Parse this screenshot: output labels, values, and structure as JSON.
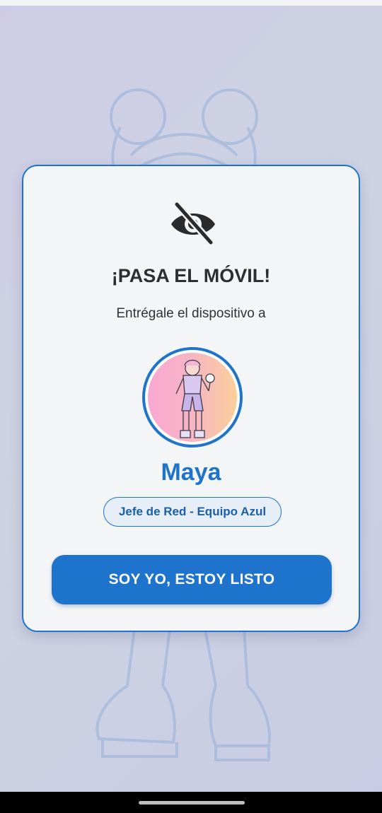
{
  "dialog": {
    "icon": "eye-slash-icon",
    "title": "¡PASA EL MÓVIL!",
    "subtitle": "Entrégale el dispositivo a",
    "player": {
      "avatar": "character-avatar",
      "name": "Maya",
      "role": "Jefe de Red - Equipo Azul"
    },
    "confirm_button": "SOY YO, ESTOY LISTO"
  },
  "colors": {
    "accent": "#1e74cc",
    "card_background": "#f4f5f7",
    "text_dark": "#2b2f33"
  }
}
